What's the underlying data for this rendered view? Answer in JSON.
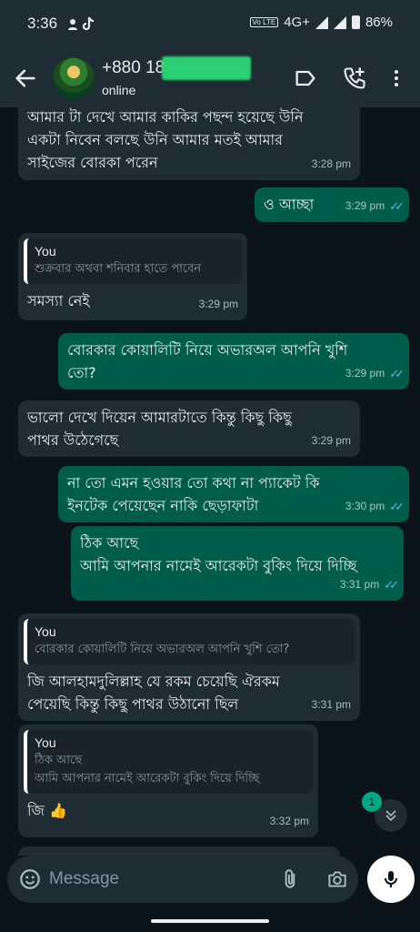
{
  "status_bar": {
    "time": "3:36",
    "network": "4G+",
    "volte": "Vo LTE",
    "battery": "86%"
  },
  "header": {
    "contact_name": "+880 18",
    "contact_status": "online",
    "icons": [
      "back-arrow-icon",
      "label-icon",
      "add-call-icon",
      "more-vert-icon"
    ]
  },
  "messages": [
    {
      "dir": "in",
      "text": "আমার টা দেখে আমার কাকির পছন্দ হয়েছে উনি\nএকটা নিবেন বলছে উনি আমার মতই আমার\nসাইজের বোরকা পরেন",
      "time": "3:28 pm"
    },
    {
      "dir": "out",
      "text": "ও আচ্ছা",
      "time": "3:29 pm"
    },
    {
      "dir": "in",
      "quote_author": "You",
      "quote_text": "শুক্রবার অথবা শনিবার হাতে পাবেন",
      "text": "সমস্যা নেই",
      "time": "3:29 pm"
    },
    {
      "dir": "out",
      "text": "বোরকার কোয়ালিটি নিয়ে অভারঅল আপনি খুশি\nতো?",
      "time": "3:29 pm"
    },
    {
      "dir": "in",
      "text": "ভালো দেখে দিয়েন আমারটাতে কিন্তু কিছু কিছু\nপাথর উঠেগেছে",
      "time": "3:29 pm"
    },
    {
      "dir": "out",
      "text": "না তো এমন হওয়ার তো কথা না প্যাকেট কি\nইনটেক পেয়েছেন নাকি ছেড়াফাটা",
      "time": "3:30 pm"
    },
    {
      "dir": "out",
      "text": "ঠিক আছে\nআমি আপনার নামেই আরেকটা বুকিং দিয়ে দিচ্ছি",
      "time": "3:31 pm"
    },
    {
      "dir": "in",
      "quote_author": "You",
      "quote_text": "বোরকার কোয়ালিটি নিয়ে অভারঅল আপনি খুশি তো?",
      "text": "জি আলহামদুলিল্লাহ যে রকম চেয়েছি ঐরকম\nপেয়েছি কিন্তু কিছু পাথর উঠানো ছিল",
      "time": "3:31 pm"
    },
    {
      "dir": "in",
      "quote_author": "You",
      "quote_text": "ঠিক আছে\nআমি আপনার নামেই আরেকটা বুকিং দিয়ে দিচ্ছি",
      "text": "জি 👍",
      "time": "3:32 pm"
    }
  ],
  "scroll": {
    "unread_count": "1"
  },
  "composer": {
    "placeholder": "Message"
  },
  "colors": {
    "incoming": "#202c33",
    "outgoing": "#005c4b",
    "background": "#0b141a",
    "accent": "#00a884",
    "read_ticks": "#53bdeb"
  }
}
